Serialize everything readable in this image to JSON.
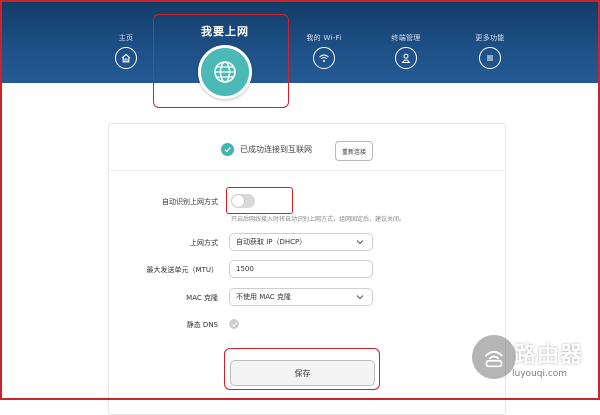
{
  "nav": {
    "items": [
      {
        "label": "主页",
        "icon": "home-icon"
      },
      {
        "label": "我要上网",
        "icon": "globe-icon",
        "active": true
      },
      {
        "label": "我的 Wi-Fi",
        "icon": "wifi-icon"
      },
      {
        "label": "终端管理",
        "icon": "user-icon"
      },
      {
        "label": "更多功能",
        "icon": "menu-icon"
      }
    ]
  },
  "status": {
    "text": "已成功连接到互联网",
    "reconnect_label": "重新连接"
  },
  "form": {
    "auto_detect": {
      "label": "自动识别上网方式",
      "enabled": false,
      "hint": "开启后网线接入时将自动识别上网方式，组网固定后，建议关闭。"
    },
    "connection_type": {
      "label": "上网方式",
      "value": "自动获取 IP（DHCP）"
    },
    "mtu": {
      "label": "最大发送单元（MTU）",
      "value": "1500"
    },
    "mac_clone": {
      "label": "MAC 克隆",
      "value": "不使用 MAC 克隆"
    },
    "static_dns": {
      "label": "静态 DNS",
      "enabled": false
    }
  },
  "save_label": "保存",
  "watermark": {
    "text": "路由器",
    "url": "luyouqi.com"
  },
  "colors": {
    "header": "#1d4f85",
    "accent": "#4bb9b5",
    "highlight": "#c9242b"
  }
}
